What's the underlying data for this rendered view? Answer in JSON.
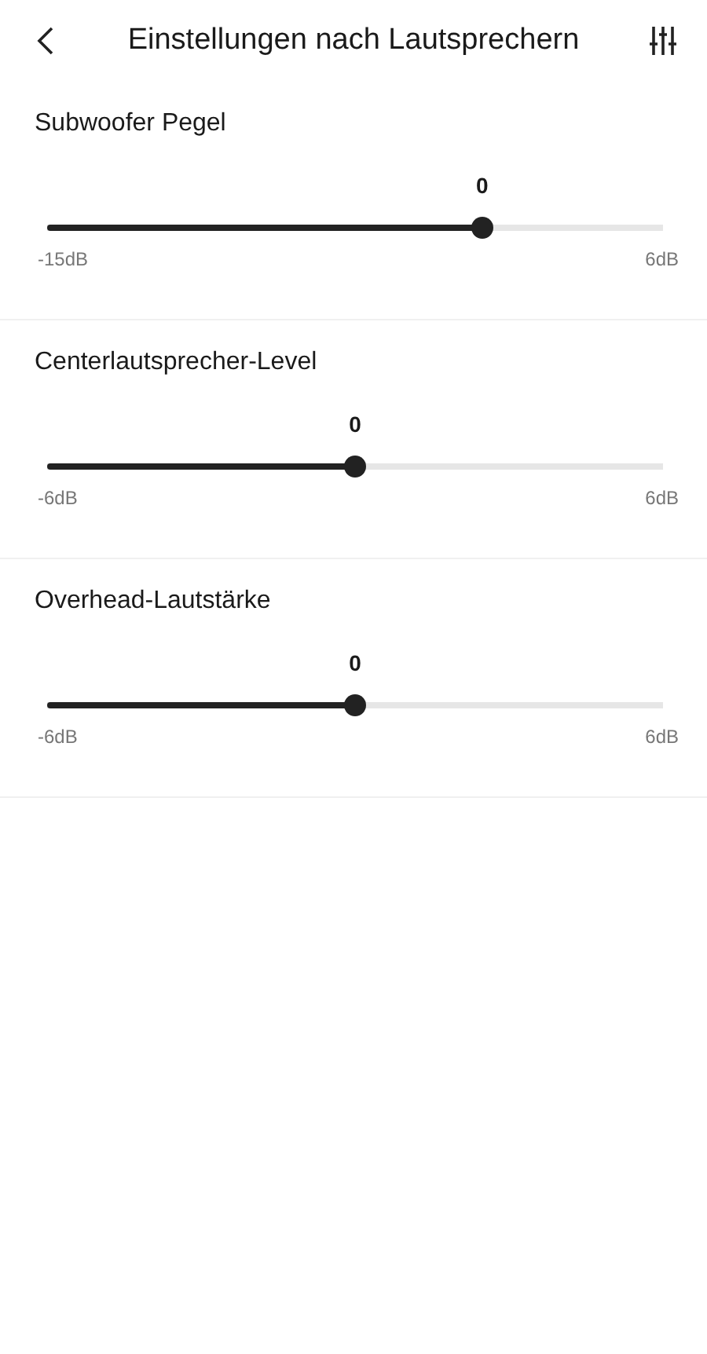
{
  "header": {
    "title": "Einstellungen nach Lautsprechern"
  },
  "sliders": [
    {
      "label": "Subwoofer Pegel",
      "value": "0",
      "level": 0.714,
      "min": "-15dB",
      "max": "6dB"
    },
    {
      "label": "Centerlautsprecher-Level",
      "value": "0",
      "level": 0.5,
      "min": "-6dB",
      "max": "6dB"
    },
    {
      "label": "Overhead-Lautstärke",
      "value": "0",
      "level": 0.5,
      "min": "-6dB",
      "max": "6dB"
    }
  ]
}
